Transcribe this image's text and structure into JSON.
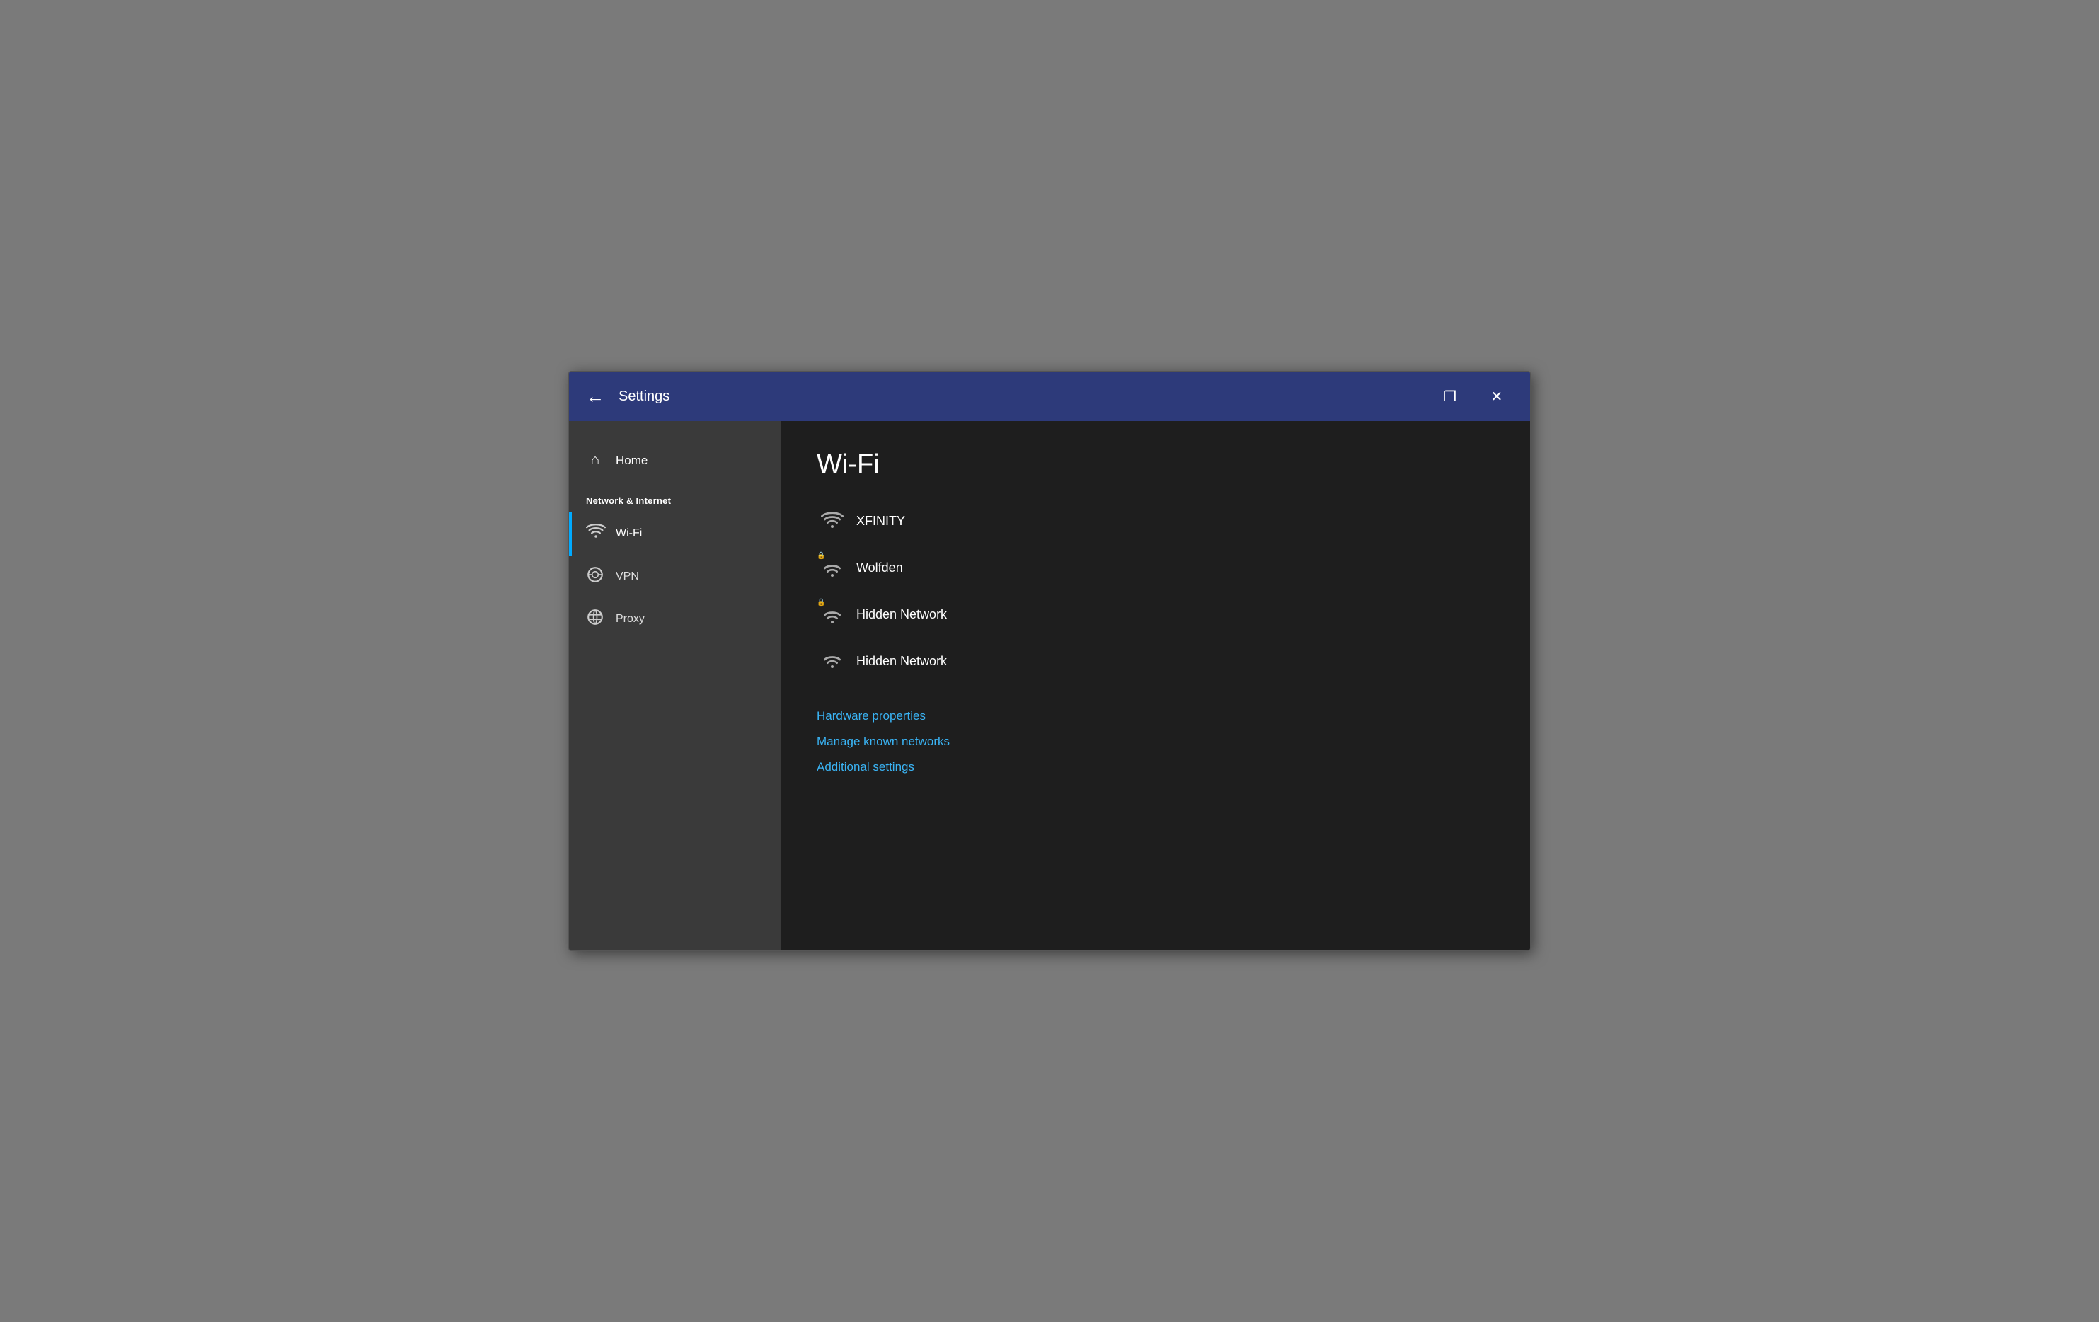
{
  "titlebar": {
    "title": "Settings",
    "back_label": "←",
    "restore_label": "❐",
    "close_label": "✕"
  },
  "sidebar": {
    "home_label": "Home",
    "home_icon": "⌂",
    "section_header": "Network & Internet",
    "items": [
      {
        "id": "wifi",
        "label": "Wi-Fi",
        "icon": "wifi",
        "active": true
      },
      {
        "id": "vpn",
        "label": "VPN",
        "icon": "vpn",
        "active": false
      },
      {
        "id": "proxy",
        "label": "Proxy",
        "icon": "globe",
        "active": false
      }
    ]
  },
  "main": {
    "page_title": "Wi-Fi",
    "networks": [
      {
        "name": "XFINITY",
        "locked": false
      },
      {
        "name": "Wolfden",
        "locked": true
      },
      {
        "name": "Hidden Network",
        "locked": true
      },
      {
        "name": "Hidden Network",
        "locked": false
      }
    ],
    "links": [
      {
        "label": "Hardware properties"
      },
      {
        "label": "Manage known networks"
      },
      {
        "label": "Additional settings"
      }
    ]
  }
}
